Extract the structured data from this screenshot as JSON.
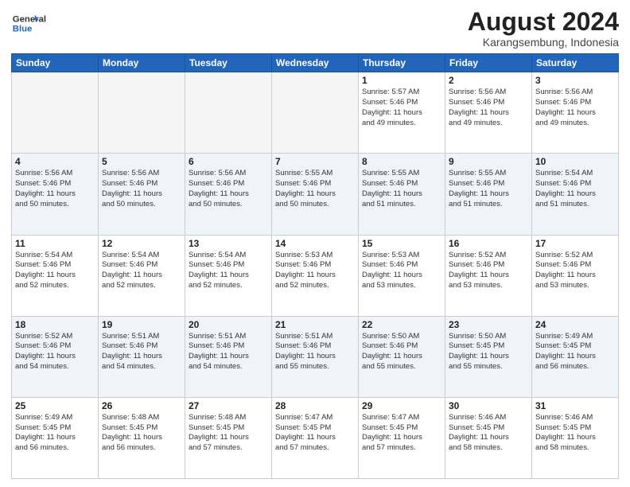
{
  "header": {
    "logo_line1": "General",
    "logo_line2": "Blue",
    "month_year": "August 2024",
    "location": "Karangsembung, Indonesia"
  },
  "days_of_week": [
    "Sunday",
    "Monday",
    "Tuesday",
    "Wednesday",
    "Thursday",
    "Friday",
    "Saturday"
  ],
  "weeks": [
    [
      {
        "day": "",
        "info": ""
      },
      {
        "day": "",
        "info": ""
      },
      {
        "day": "",
        "info": ""
      },
      {
        "day": "",
        "info": ""
      },
      {
        "day": "1",
        "info": "Sunrise: 5:57 AM\nSunset: 5:46 PM\nDaylight: 11 hours\nand 49 minutes."
      },
      {
        "day": "2",
        "info": "Sunrise: 5:56 AM\nSunset: 5:46 PM\nDaylight: 11 hours\nand 49 minutes."
      },
      {
        "day": "3",
        "info": "Sunrise: 5:56 AM\nSunset: 5:46 PM\nDaylight: 11 hours\nand 49 minutes."
      }
    ],
    [
      {
        "day": "4",
        "info": "Sunrise: 5:56 AM\nSunset: 5:46 PM\nDaylight: 11 hours\nand 50 minutes."
      },
      {
        "day": "5",
        "info": "Sunrise: 5:56 AM\nSunset: 5:46 PM\nDaylight: 11 hours\nand 50 minutes."
      },
      {
        "day": "6",
        "info": "Sunrise: 5:56 AM\nSunset: 5:46 PM\nDaylight: 11 hours\nand 50 minutes."
      },
      {
        "day": "7",
        "info": "Sunrise: 5:55 AM\nSunset: 5:46 PM\nDaylight: 11 hours\nand 50 minutes."
      },
      {
        "day": "8",
        "info": "Sunrise: 5:55 AM\nSunset: 5:46 PM\nDaylight: 11 hours\nand 51 minutes."
      },
      {
        "day": "9",
        "info": "Sunrise: 5:55 AM\nSunset: 5:46 PM\nDaylight: 11 hours\nand 51 minutes."
      },
      {
        "day": "10",
        "info": "Sunrise: 5:54 AM\nSunset: 5:46 PM\nDaylight: 11 hours\nand 51 minutes."
      }
    ],
    [
      {
        "day": "11",
        "info": "Sunrise: 5:54 AM\nSunset: 5:46 PM\nDaylight: 11 hours\nand 52 minutes."
      },
      {
        "day": "12",
        "info": "Sunrise: 5:54 AM\nSunset: 5:46 PM\nDaylight: 11 hours\nand 52 minutes."
      },
      {
        "day": "13",
        "info": "Sunrise: 5:54 AM\nSunset: 5:46 PM\nDaylight: 11 hours\nand 52 minutes."
      },
      {
        "day": "14",
        "info": "Sunrise: 5:53 AM\nSunset: 5:46 PM\nDaylight: 11 hours\nand 52 minutes."
      },
      {
        "day": "15",
        "info": "Sunrise: 5:53 AM\nSunset: 5:46 PM\nDaylight: 11 hours\nand 53 minutes."
      },
      {
        "day": "16",
        "info": "Sunrise: 5:52 AM\nSunset: 5:46 PM\nDaylight: 11 hours\nand 53 minutes."
      },
      {
        "day": "17",
        "info": "Sunrise: 5:52 AM\nSunset: 5:46 PM\nDaylight: 11 hours\nand 53 minutes."
      }
    ],
    [
      {
        "day": "18",
        "info": "Sunrise: 5:52 AM\nSunset: 5:46 PM\nDaylight: 11 hours\nand 54 minutes."
      },
      {
        "day": "19",
        "info": "Sunrise: 5:51 AM\nSunset: 5:46 PM\nDaylight: 11 hours\nand 54 minutes."
      },
      {
        "day": "20",
        "info": "Sunrise: 5:51 AM\nSunset: 5:46 PM\nDaylight: 11 hours\nand 54 minutes."
      },
      {
        "day": "21",
        "info": "Sunrise: 5:51 AM\nSunset: 5:46 PM\nDaylight: 11 hours\nand 55 minutes."
      },
      {
        "day": "22",
        "info": "Sunrise: 5:50 AM\nSunset: 5:46 PM\nDaylight: 11 hours\nand 55 minutes."
      },
      {
        "day": "23",
        "info": "Sunrise: 5:50 AM\nSunset: 5:45 PM\nDaylight: 11 hours\nand 55 minutes."
      },
      {
        "day": "24",
        "info": "Sunrise: 5:49 AM\nSunset: 5:45 PM\nDaylight: 11 hours\nand 56 minutes."
      }
    ],
    [
      {
        "day": "25",
        "info": "Sunrise: 5:49 AM\nSunset: 5:45 PM\nDaylight: 11 hours\nand 56 minutes."
      },
      {
        "day": "26",
        "info": "Sunrise: 5:48 AM\nSunset: 5:45 PM\nDaylight: 11 hours\nand 56 minutes."
      },
      {
        "day": "27",
        "info": "Sunrise: 5:48 AM\nSunset: 5:45 PM\nDaylight: 11 hours\nand 57 minutes."
      },
      {
        "day": "28",
        "info": "Sunrise: 5:47 AM\nSunset: 5:45 PM\nDaylight: 11 hours\nand 57 minutes."
      },
      {
        "day": "29",
        "info": "Sunrise: 5:47 AM\nSunset: 5:45 PM\nDaylight: 11 hours\nand 57 minutes."
      },
      {
        "day": "30",
        "info": "Sunrise: 5:46 AM\nSunset: 5:45 PM\nDaylight: 11 hours\nand 58 minutes."
      },
      {
        "day": "31",
        "info": "Sunrise: 5:46 AM\nSunset: 5:45 PM\nDaylight: 11 hours\nand 58 minutes."
      }
    ]
  ]
}
